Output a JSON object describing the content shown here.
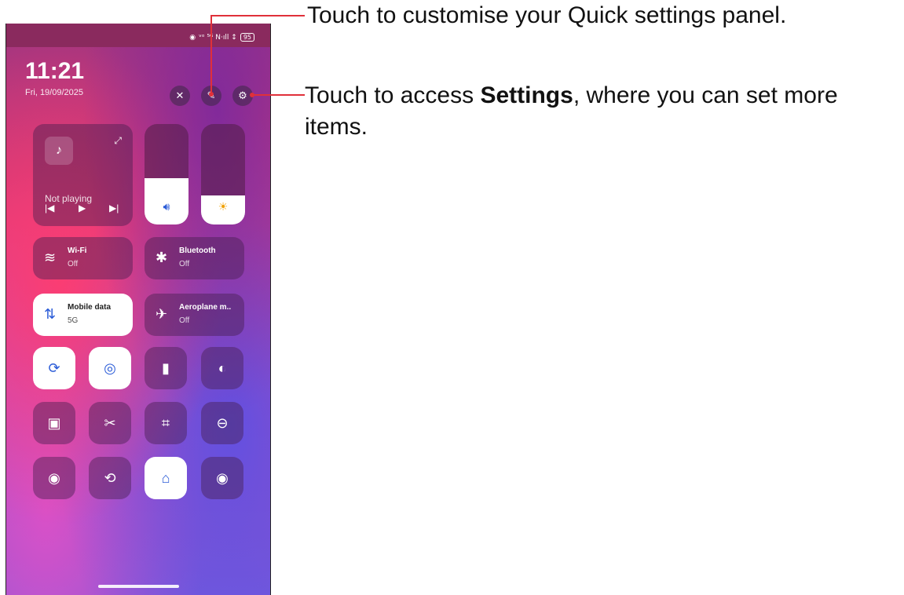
{
  "status_bar": {
    "battery": "95",
    "signal_text": "ᵛᵒ ⁵ᴳ N·ıll ↕"
  },
  "header": {
    "time": "11:21",
    "date": "Fri, 19/09/2025"
  },
  "header_icons": [
    "flashlight-off-icon",
    "edit-icon",
    "settings-icon"
  ],
  "media": {
    "status": "Not playing"
  },
  "tiles": {
    "wifi": {
      "label": "Wi-Fi",
      "state": "Off"
    },
    "bluetooth": {
      "label": "Bluetooth",
      "state": "Off"
    },
    "mobile_data": {
      "label": "Mobile data",
      "state": "5G"
    },
    "aeroplane": {
      "label": "Aeroplane m..",
      "state": "Off"
    }
  },
  "sliders": {
    "volume_level": 0.46,
    "brightness_level": 0.29
  },
  "callouts": {
    "edit": "Touch to customise your Quick settings panel.",
    "settings_pre": "Touch to access ",
    "settings_bold": "Settings",
    "settings_post": ", where you can set more items."
  },
  "colors": {
    "accent_blue": "#2a5bd7",
    "callout_line": "#e0303a"
  }
}
